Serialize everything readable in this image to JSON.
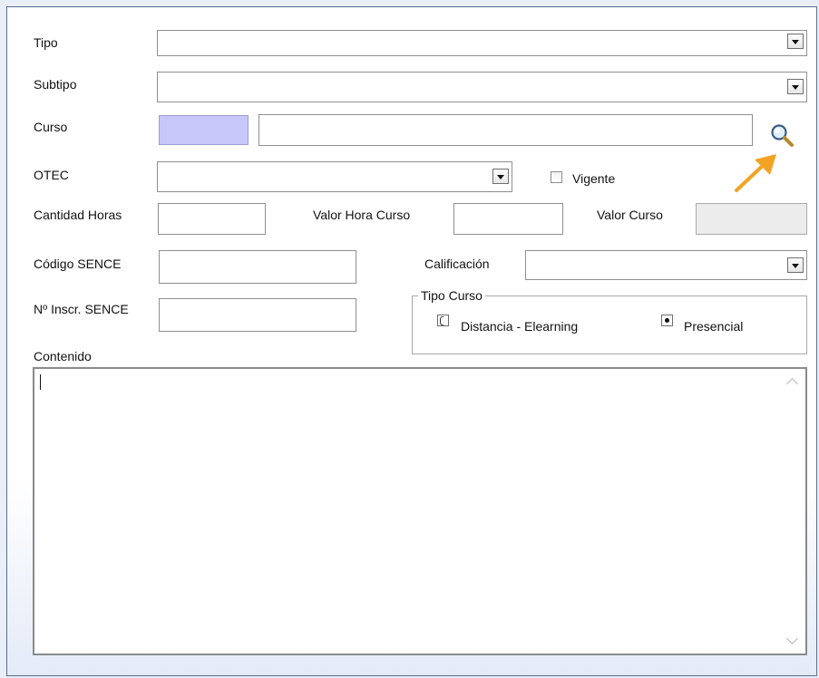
{
  "form": {
    "tipo": {
      "label": "Tipo",
      "value": ""
    },
    "subtipo": {
      "label": "Subtipo",
      "value": ""
    },
    "curso": {
      "label": "Curso",
      "code": "",
      "name": ""
    },
    "otec": {
      "label": "OTEC",
      "value": ""
    },
    "vigente": {
      "label": "Vigente",
      "checked": false
    },
    "cantidad_horas": {
      "label": "Cantidad Horas",
      "value": ""
    },
    "valor_hora_curso": {
      "label": "Valor Hora Curso",
      "value": ""
    },
    "valor_curso": {
      "label": "Valor Curso",
      "value": ""
    },
    "codigo_sence": {
      "label": "Código SENCE",
      "value": ""
    },
    "calificacion": {
      "label": "Calificación",
      "value": ""
    },
    "inscr_sence": {
      "label": "Nº Inscr. SENCE",
      "value": ""
    },
    "tipo_curso": {
      "legend": "Tipo Curso",
      "options": [
        "Distancia - Elearning",
        "Presencial"
      ],
      "selected": "Presencial"
    },
    "contenido": {
      "label": "Contenido",
      "value": ""
    }
  },
  "icons": {
    "search": "magnifier-icon",
    "arrow": "orange-arrow-annotation"
  },
  "colors": {
    "accent_arrow": "#f2a325",
    "curso_code_bg": "#c7c7f9"
  }
}
